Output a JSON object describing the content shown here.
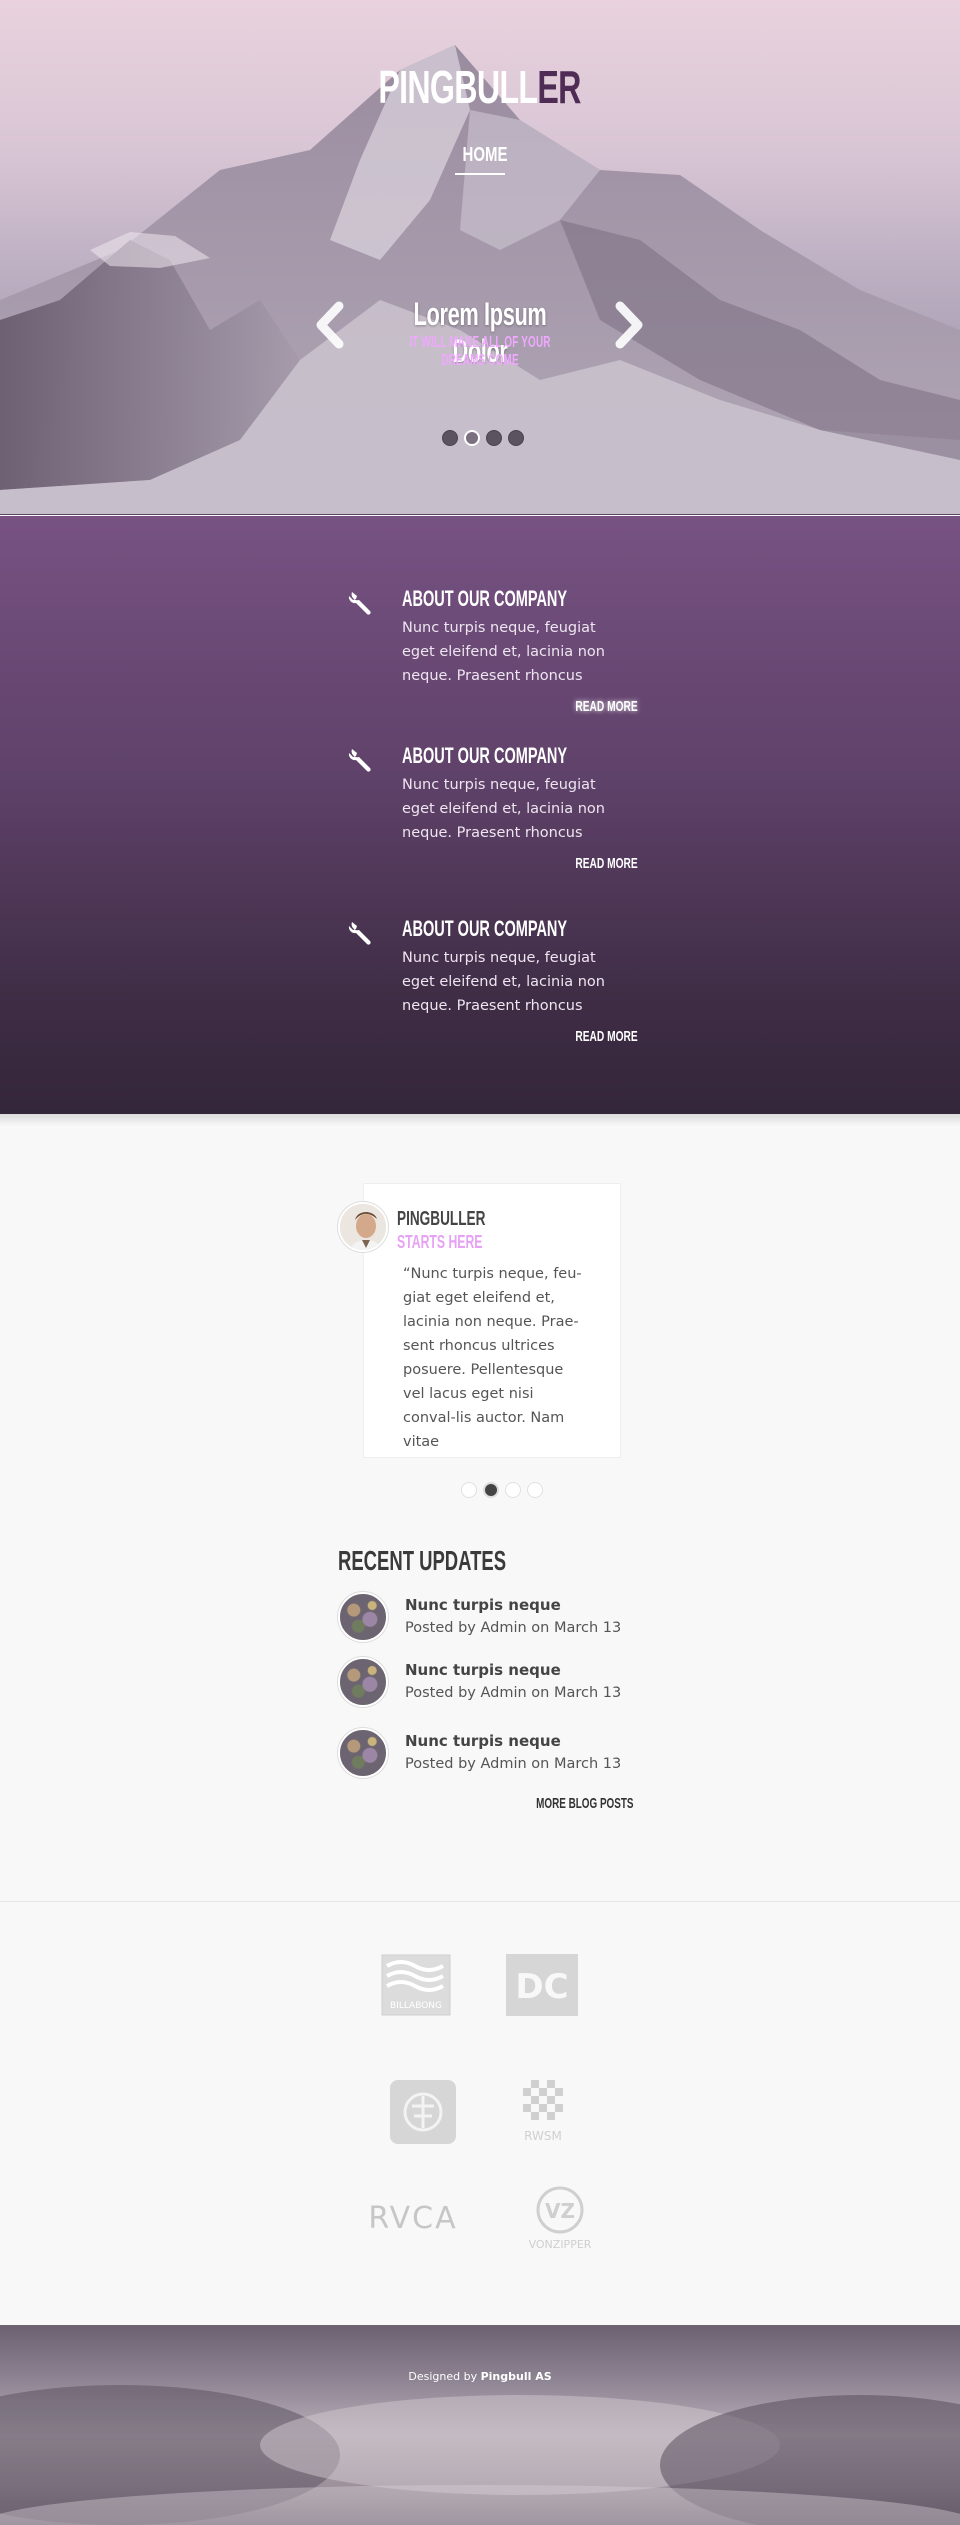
{
  "site": {
    "logo_main": "PINGBULL",
    "logo_accent": "ER",
    "nav_home": "HOME"
  },
  "slider": {
    "title": "Lorem Ipsum Dolor",
    "subtitle": "IT WILL MAKE ALL OF YOUR DREAMS COME",
    "active_dot": 2,
    "dot_count": 4
  },
  "features": [
    {
      "icon": "wrench-icon",
      "title": "ABOUT OUR COMPANY",
      "text": "Nunc turpis neque, feugiat eget eleifend et, lacinia non neque. Praesent rhoncus",
      "link": "READ MORE"
    },
    {
      "icon": "wrench-icon",
      "title": "ABOUT OUR COMPANY",
      "text": "Nunc turpis neque, feugiat eget eleifend et, lacinia non neque. Praesent rhoncus",
      "link": "READ MORE"
    },
    {
      "icon": "wrench-icon",
      "title": "ABOUT OUR COMPANY",
      "text": "Nunc turpis neque, feugiat eget eleifend et, lacinia non neque. Praesent rhoncus",
      "link": "READ MORE"
    }
  ],
  "testimonial": {
    "name": "PINGBULLER",
    "tagline": "STARTS HERE",
    "quote": "“Nunc turpis neque, feu-giat eget eleifend et, lacinia non neque. Prae-sent rhoncus ultrices posuere. Pellentesque vel lacus eget nisi conval-lis auctor. Nam vitae",
    "active_dot": 2,
    "dot_count": 4
  },
  "recent_updates": {
    "title": "RECENT UPDATES",
    "posts": [
      {
        "title": "Nunc turpis neque",
        "meta": "Posted by Admin on March 13"
      },
      {
        "title": "Nunc turpis neque",
        "meta": "Posted by Admin on March 13"
      },
      {
        "title": "Nunc turpis neque",
        "meta": "Posted by Admin on March 13"
      }
    ],
    "more_link": "MORE BLOG POSTS"
  },
  "brands": {
    "billabong": "BILLABONG",
    "rvca": "RVCA",
    "vonzipper": "VONZIPPER",
    "rwsm": "RWSM",
    "dc": "DC",
    "element": "ELEMENT"
  },
  "footer": {
    "credit_prefix": "Designed by",
    "credit_name": "Pingbull AS"
  },
  "colors": {
    "accent_purple": "#775283",
    "accent_pink": "#e6a2f4",
    "logo_accent": "#4f2c56"
  }
}
